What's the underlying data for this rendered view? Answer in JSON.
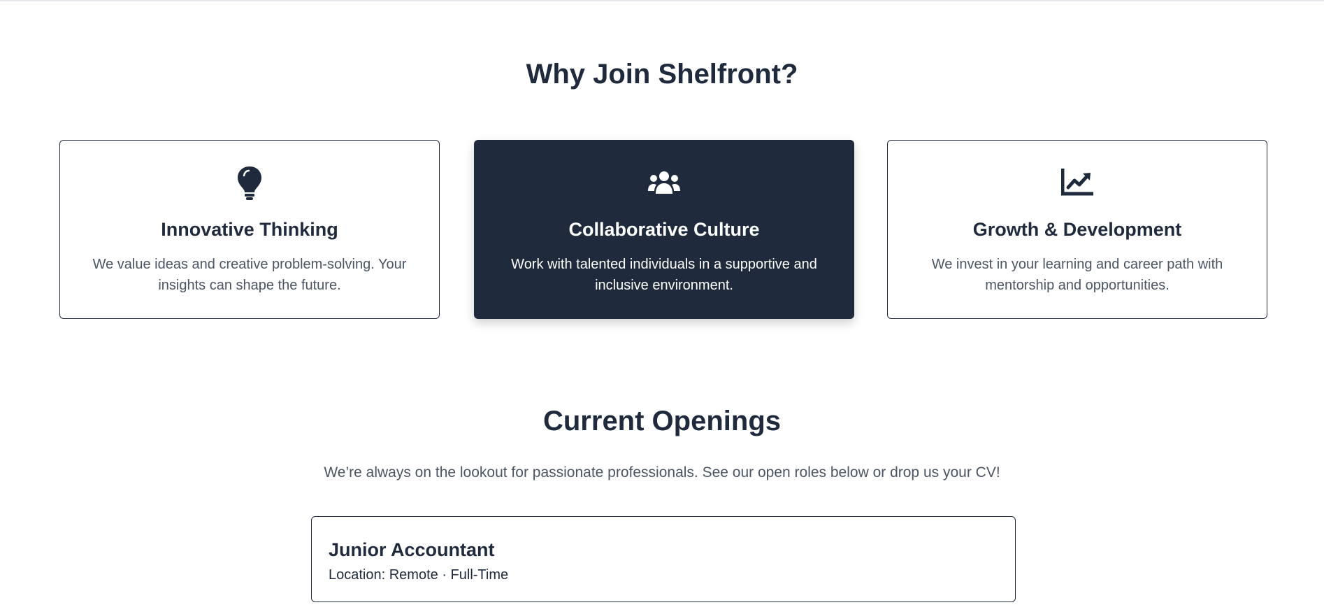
{
  "why": {
    "title": "Why Join Shelfront?",
    "cards": [
      {
        "icon": "lightbulb-icon",
        "title": "Innovative Thinking",
        "description": "We value ideas and creative problem-solving. Your insights can shape the future."
      },
      {
        "icon": "users-icon",
        "title": "Collaborative Culture",
        "description": "Work with talented individuals in a supportive and inclusive environment."
      },
      {
        "icon": "chart-line-icon",
        "title": "Growth & Development",
        "description": "We invest in your learning and career path with mentorship and opportunities."
      }
    ]
  },
  "openings": {
    "title": "Current Openings",
    "subtitle": "We’re always on the lookout for passionate professionals. See our open roles below or drop us your CV!",
    "jobs": [
      {
        "title": "Junior Accountant",
        "meta": "Location: Remote · Full-Time"
      }
    ]
  },
  "colors": {
    "primary": "#1f2a3c",
    "text_muted": "#4b5563",
    "background": "#ffffff"
  }
}
